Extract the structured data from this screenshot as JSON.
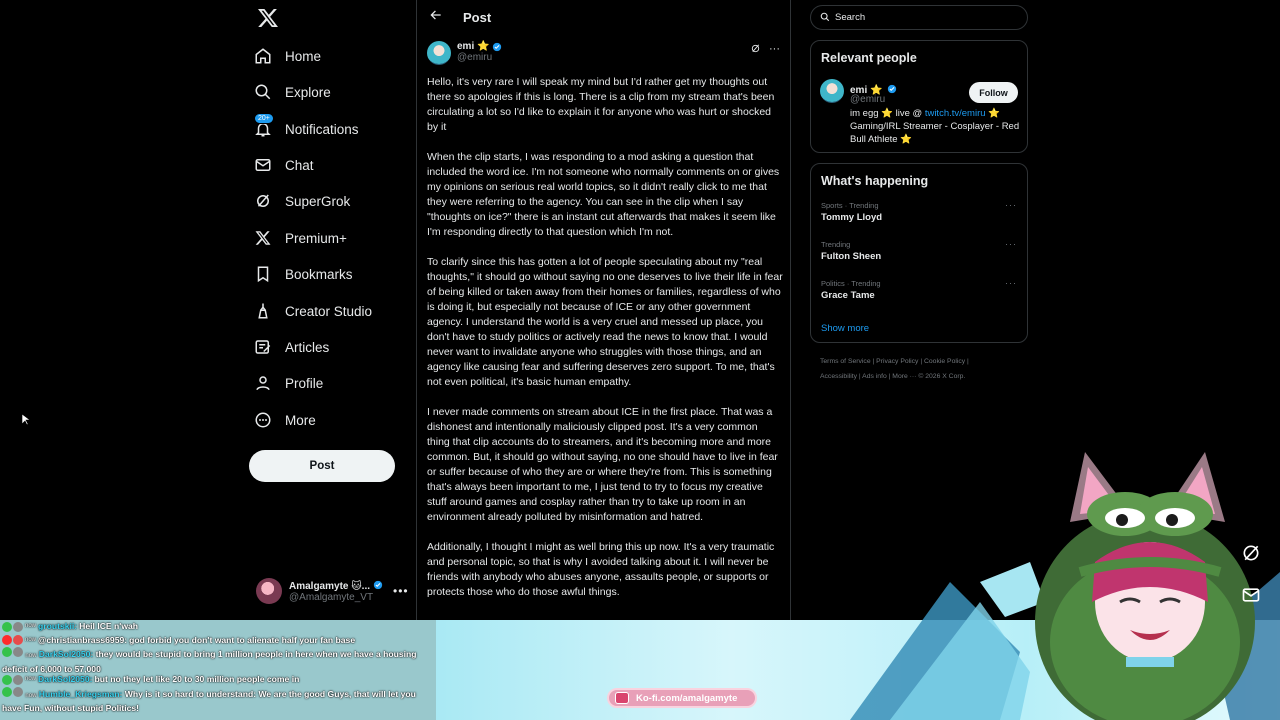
{
  "nav": {
    "items": [
      {
        "label": "Home",
        "icon": "home-icon"
      },
      {
        "label": "Explore",
        "icon": "search-icon"
      },
      {
        "label": "Notifications",
        "icon": "bell-icon",
        "badge": "20+"
      },
      {
        "label": "Chat",
        "icon": "mail-icon"
      },
      {
        "label": "SuperGrok",
        "icon": "grok-icon"
      },
      {
        "label": "Premium+",
        "icon": "x-logo-icon"
      },
      {
        "label": "Bookmarks",
        "icon": "bookmark-icon"
      },
      {
        "label": "Creator Studio",
        "icon": "lightning-icon"
      },
      {
        "label": "Articles",
        "icon": "article-icon"
      },
      {
        "label": "Profile",
        "icon": "person-icon"
      },
      {
        "label": "More",
        "icon": "more-circle-icon"
      }
    ],
    "post_button": "Post",
    "account": {
      "name": "Amalgamyte 🐱...",
      "handle": "@Amalgamyte_VT"
    }
  },
  "post": {
    "header_title": "Post",
    "author_name": "emi ⭐",
    "author_handle": "@emiru",
    "paragraphs": [
      "Hello, it's very rare I will speak my mind but I'd rather get my thoughts out there so apologies if this is long. There is a clip from my stream that's been circulating a lot so I'd like to explain it for anyone who was hurt or shocked by it",
      "When the clip starts, I was responding to a mod asking a question that included the word ice. I'm not someone who normally comments on or gives my opinions on serious real world topics, so it didn't really click to me that they were referring to the agency. You can see in the clip when I say \"thoughts on ice?\" there is an instant cut afterwards that makes it seem like I'm responding directly to that question which I'm not.",
      "To clarify since this has gotten a lot of people speculating about my \"real thoughts,\" it should go without saying no one deserves to live their life in fear of being killed or taken away from their homes or families, regardless of who is doing it, but especially not because of ICE or any other government agency. I understand the world is a very cruel and messed up place, you don't have to study politics or actively read the news to know that. I would never want to invalidate anyone who struggles with those things, and an agency like causing fear and suffering deserves zero support. To me, that's not even political, it's basic human empathy.",
      "I never made comments on stream about ICE in the first place. That was a dishonest and intentionally maliciously clipped post. It's a very common thing that clip accounts do to streamers, and it's becoming more and more common. But, it should go without saying, no one should have to live in fear or suffer because of who they are or where they're from. This is something that's always been important to me, I just tend to try to focus my creative stuff around games and cosplay rather than try to take up room in an environment already polluted by misinformation and hatred.",
      "Additionally, I thought I might as well bring this up now. It's a very traumatic and personal topic, so that is why I avoided talking about it. I will never be friends with anybody who abuses anyone, assaults people, or supports or protects those who do those awful things."
    ]
  },
  "right": {
    "search_placeholder": "Search",
    "relevant_title": "Relevant people",
    "relevant": {
      "name": "emi ⭐",
      "handle": "@emiru",
      "follow": "Follow",
      "bio_prefix": "im egg ⭐ live @ ",
      "bio_link": "twitch.tv/emiru",
      "bio_suffix": " ⭐ Gaming/IRL Streamer - Cosplayer - Red Bull Athlete ⭐"
    },
    "happening_title": "What's happening",
    "trends": [
      {
        "meta": "Sports · Trending",
        "topic": "Tommy Lloyd"
      },
      {
        "meta": "Trending",
        "topic": "Fulton Sheen"
      },
      {
        "meta": "Politics · Trending",
        "topic": "Grace Tame"
      }
    ],
    "show_more": "Show more",
    "footer_line1": "Terms of Service  |  Privacy Policy  |  Cookie Policy  |",
    "footer_line2": "Accessibility  |  Ads info  |  More ···  © 2026 X Corp."
  },
  "chat": [
    {
      "platforms": [
        "#35c24b",
        "#888"
      ],
      "time": "now",
      "user": "groutskii:",
      "msg": "Heil ICE n'wah"
    },
    {
      "platforms": [
        "#ff2b2b",
        "#e64c4c"
      ],
      "time": "now",
      "user": "@christianbrass6959:",
      "msg": "god forbid you don't want to alienate half your fan base"
    },
    {
      "platforms": [
        "#35c24b",
        "#888"
      ],
      "time": "now",
      "user": "DarkSol2050:",
      "msg": "they would be stupid to bring 1 million people in here when we have a housing deficit of 6,000 to 57,000",
      "wrap": true
    },
    {
      "platforms": [
        "#35c24b",
        "#888"
      ],
      "time": "now",
      "user": "DarkSol2050:",
      "msg": "but no they let like 20 to 30 million people come in"
    },
    {
      "platforms": [
        "#35c24b",
        "#888"
      ],
      "time": "now",
      "user": "Humble_Kriegsman:",
      "msg": "Why is it so hard to understand: We are the good Guys, that will let you have Fun, without stupid Politics!",
      "wrap": true
    }
  ],
  "kofi": "Ko-fi.com/amalgamyte",
  "colors": {
    "accent": "#1d9bf0",
    "background": "#000000",
    "border": "#2f3336",
    "muted": "#71767b"
  }
}
